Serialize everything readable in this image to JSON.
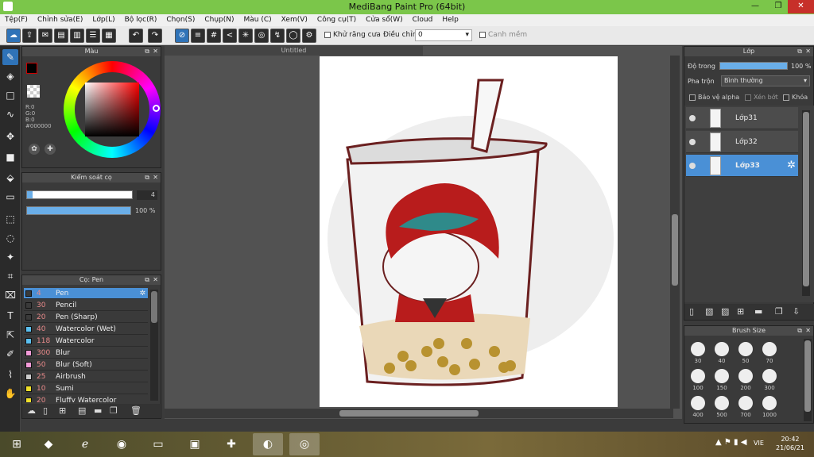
{
  "window": {
    "title": "MediBang Paint Pro (64bit)",
    "minimize": "—",
    "restore": "❐",
    "close": "✕"
  },
  "menu": [
    "Tệp(F)",
    "Chỉnh sửa(E)",
    "Lớp(L)",
    "Bộ lọc(R)",
    "Chọn(S)",
    "Chụp(N)",
    "Màu (C)",
    "Xem(V)",
    "Công cụ(T)",
    "Cửa sổ(W)",
    "Cloud",
    "Help"
  ],
  "toolbar": {
    "antialias_label": "Khử răng cưa",
    "adjust_label": "Điều chỉnh",
    "adjust_value": "0",
    "smart_fill_label": "Canh mềm"
  },
  "color_panel": {
    "title": "Màu",
    "r": "R:0",
    "g": "G:0",
    "b": "B:0",
    "hex": "#000000",
    "primary": "#000000",
    "secondary": "#ffffff",
    "accent_hue": "#ff0000"
  },
  "brush_control": {
    "title": "Kiểm soát cọ",
    "size_value": "4",
    "opacity_value": "100 %",
    "opacity": 1.0
  },
  "brush_panel": {
    "title": "Cọ: Pen",
    "items": [
      {
        "size": "4",
        "name": "Pen",
        "color": "#3a3a3a"
      },
      {
        "size": "30",
        "name": "Pencil",
        "color": "#3a3a3a"
      },
      {
        "size": "20",
        "name": "Pen (Sharp)",
        "color": "#3a3a3a"
      },
      {
        "size": "40",
        "name": "Watercolor (Wet)",
        "color": "#5bc0f0"
      },
      {
        "size": "118",
        "name": "Watercolor",
        "color": "#5bc0f0"
      },
      {
        "size": "300",
        "name": "Blur",
        "color": "#f29bd8"
      },
      {
        "size": "50",
        "name": "Blur (Soft)",
        "color": "#f29bd8"
      },
      {
        "size": "25",
        "name": "Airbrush",
        "color": "#cccccc"
      },
      {
        "size": "10",
        "name": "Sumi",
        "color": "#f0e02a"
      },
      {
        "size": "20",
        "name": "Fluffy Watercolor",
        "color": "#f0e02a"
      }
    ]
  },
  "canvas": {
    "tab_title": "Untitled"
  },
  "layer_panel": {
    "title": "Lớp",
    "opacity_label": "Độ trong",
    "opacity_value": "100 %",
    "opacity": 1.0,
    "blend_label": "Pha trộn",
    "blend_value": "Bình thường",
    "protect_alpha": "Bảo vệ alpha",
    "clipping": "Xén bớt",
    "lock": "Khóa",
    "layers": [
      {
        "name": "Lớp31",
        "selected": false
      },
      {
        "name": "Lớp32",
        "selected": false
      },
      {
        "name": "Lớp33",
        "selected": true
      }
    ]
  },
  "brush_size_panel": {
    "title": "Brush Size",
    "sizes": [
      "30",
      "40",
      "50",
      "70",
      "100",
      "150",
      "200",
      "300",
      "400",
      "500",
      "700",
      "1000"
    ]
  },
  "taskbar": {
    "lang": "VIE",
    "time": "20:42",
    "date": "21/06/21"
  }
}
